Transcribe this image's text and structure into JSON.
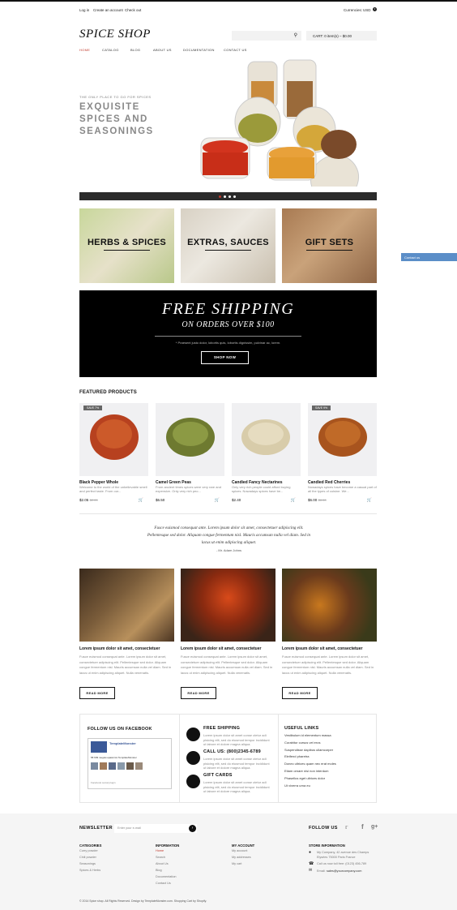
{
  "topbar": {
    "login": "Log in",
    "create": "Create an account",
    "checkout": "Check out",
    "currency_label": "Currencies:",
    "currency": "USD"
  },
  "logo": "SPICE SHOP",
  "cart": {
    "label": "CART:",
    "items": "0 item(s) – $0.00"
  },
  "nav": [
    "HOME",
    "CATALOG",
    "BLOG",
    "ABOUT US",
    "DOCUMENTATION",
    "CONTACT US"
  ],
  "hero": {
    "sub": "THE ONLY PLACE TO GO FOR SPICES",
    "title": "EXQUISITE SPICES AND SEASONINGS"
  },
  "categories": [
    "HERBS & SPICES",
    "EXTRAS, SAUCES",
    "GIFT SETS"
  ],
  "shipping": {
    "t1": "FREE SHIPPING",
    "t2": "ON ORDERS OVER $100",
    "t3": "* Praesent justo dolor, lobortis quis, lobortis dignissim, pulvinar ac, lorem.",
    "btn": "SHOP NOW"
  },
  "featured": {
    "title": "FEATURED PRODUCTS",
    "items": [
      {
        "badge": "SAVE 7%",
        "name": "Black Pepper Whole",
        "desc": "Welcome to the world of the unbelievable smell and perfect taste. From our...",
        "price": "$2.05",
        "old": "$2.20"
      },
      {
        "badge": "",
        "name": "Camel Green Peas",
        "desc": "From ancient times spices were very rare and expensive. Only very rich peo...",
        "price": "$6.50",
        "old": ""
      },
      {
        "badge": "",
        "name": "Candied Fancy Nectarines",
        "desc": "Only very rich people could afford buying spices. Nowadays spices have be...",
        "price": "$2.40",
        "old": ""
      },
      {
        "badge": "SAVE 9%",
        "name": "Candied Red Cherries",
        "desc": "Nowadays spices have become a casual part of all the types of cuisine. We...",
        "price": "$6.00",
        "old": "$6.60"
      }
    ]
  },
  "quote": {
    "text": "Fusce euismod consequat ante. Lorem ipsum dolor sit amet, consectetuer adipiscing elit. Pellentesque sed dolor. Aliquam congue fermentum nisl. Mauris accumsan nulla vel diam. Sed in lacus ut enim adipiscing aliquet.",
    "author": "- Mr. Adam Johns"
  },
  "blog": [
    {
      "title": "Lorem ipsum dolor sit amet, consectetuer",
      "text": "Fusce euismod consequat ante. Lorem ipsum dolor sit amet, consectetuer adipiscing elit. Pellentesque sed dolor. Aliquam congue fermentum nisl. Mauris accumsan nulla vel diam. Sed in lacus ut enim adipiscing aliquet. Nulla venenatis.",
      "btn": "READ MORE"
    },
    {
      "title": "Lorem ipsum dolor sit amet, consectetuer",
      "text": "Fusce euismod consequat ante. Lorem ipsum dolor sit amet, consectetuer adipiscing elit. Pellentesque sed dolor. Aliquam congue fermentum nisl. Mauris accumsan nulla vel diam. Sed in lacus ut enim adipiscing aliquet. Nulla venenatis.",
      "btn": "READ MORE"
    },
    {
      "title": "Lorem ipsum dolor sit amet, consectetuer",
      "text": "Fusce euismod consequat ante. Lorem ipsum dolor sit amet, consectetuer adipiscing elit. Pellentesque sed dolor. Aliquam congue fermentum nisl. Mauris accumsan nulla vel diam. Sed in lacus ut enim adipiscing aliquet. Nulla venenatis.",
      "btn": "READ MORE"
    }
  ],
  "facebook": {
    "title": "FOLLOW US ON FACEBOOK",
    "page": "TemplateMonster",
    "likes": "58 609 людям нравится TemplateMonster",
    "plugin": "Facebook social plugin"
  },
  "services": [
    {
      "title": "FREE SHIPPING",
      "text": "Lorem ipsum dolor sit amet conse ctetur adi pisicing elit, sed do eiusmod tempor incididunt ut labore et dolore magna aliqua."
    },
    {
      "title": "CALL US: (800)2345-6789",
      "text": "Lorem ipsum dolor sit amet conse ctetur adi pisicing elit, sed do eiusmod tempor incididunt ut labore et dolore magna aliqua."
    },
    {
      "title": "GIFT CARDS",
      "text": "Lorem ipsum dolor sit amet conse ctetur adi pisicing elit, sed do eiusmod tempor incididunt ut labore et dolore magna aliqua."
    }
  ],
  "useful": {
    "title": "USEFUL LINKS",
    "links": [
      "Vestibulum id elementum massa",
      "Curabitur cursus vel eros",
      "Suspendisse dapibus ullamcorper",
      "Eleifend pharetra",
      "Donec ultrices quam nec erat moles",
      "Etiam ornare nisi non interdum",
      "Phasellus eget ultrices dolor",
      "Ut viverra urna eu"
    ]
  },
  "footer": {
    "newsletter": "NEWSLETTER",
    "email_ph": "Enter your e-mail",
    "follow": "FOLLOW US",
    "categories": {
      "title": "CATEGORIES",
      "items": [
        "Curry powder",
        "Chili powder",
        "Seasonings",
        "Spices & Herbs"
      ]
    },
    "information": {
      "title": "INFORMATION",
      "items": [
        "Home",
        "Search",
        "About Us",
        "Blog",
        "Documentation",
        "Contact Us"
      ]
    },
    "account": {
      "title": "MY ACCOUNT",
      "items": [
        "My account",
        "My addresses",
        "My cart"
      ]
    },
    "store": {
      "title": "STORE INFORMATION",
      "address": "My Company, 42 avenue des Champs Elysées 75000 Paris France",
      "phone": "Call us now toll free: (0123) 456-789",
      "email_label": "Email:",
      "email": "sales@yourcompany.com"
    },
    "copyright": "© 2014 Spice shop. All Rights Reserved. Design by TemplateMonster.com. Shopping Cart by Shopify."
  },
  "contact_tab": "Contact us",
  "colors": {
    "accent": "#c0392b",
    "dark": "#111111",
    "contact_tab": "#5b8ec8"
  }
}
